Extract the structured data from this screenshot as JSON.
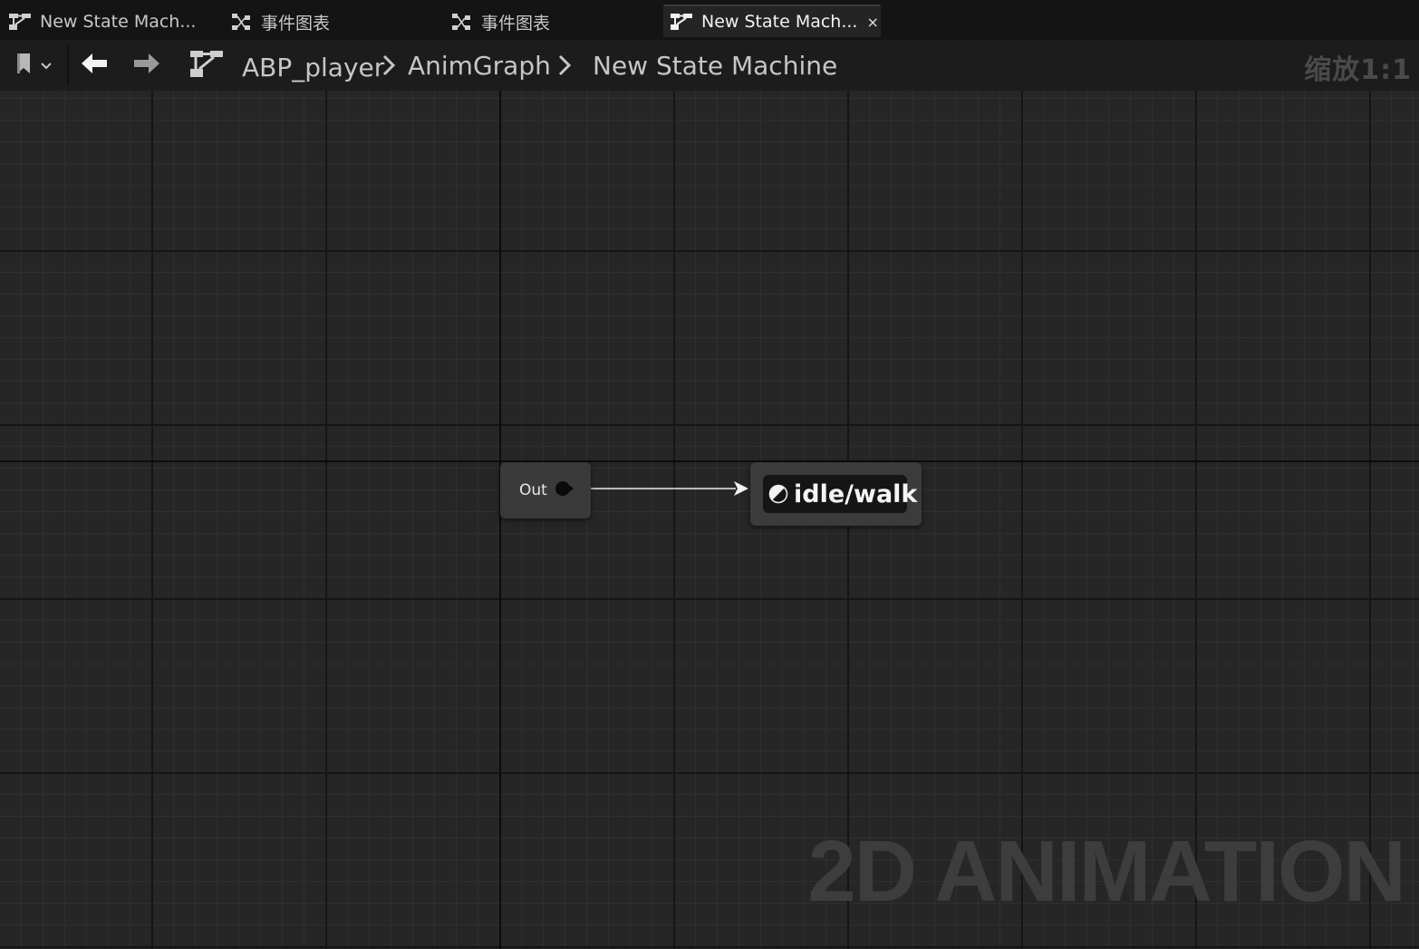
{
  "tabs": [
    {
      "label": "New State Mach...",
      "icon": "state-machine-icon",
      "active": false
    },
    {
      "label": "事件图表",
      "icon": "event-graph-icon",
      "active": false
    },
    {
      "label": "事件图表",
      "icon": "event-graph-icon",
      "active": false
    },
    {
      "label": "New State Mach...",
      "icon": "state-machine-icon",
      "active": true,
      "close": "×"
    }
  ],
  "toolbar": {
    "bookmark_icon": "bookmark-icon",
    "back_icon": "back-arrow-icon",
    "forward_icon": "forward-arrow-icon",
    "graph_icon": "state-machine-icon",
    "breadcrumbs": [
      "ABP_player",
      "AnimGraph",
      "New State Machine"
    ],
    "zoom": "缩放1:1"
  },
  "graph": {
    "entry_node": {
      "label": "Out"
    },
    "state_node": {
      "name": "idle/walk",
      "icon": "state-icon"
    }
  },
  "watermark": "2D ANIMATION",
  "colors": {
    "background": "#262626",
    "tabbar": "#141414",
    "node": "#3a3a3a",
    "node_inner": "#151515"
  }
}
